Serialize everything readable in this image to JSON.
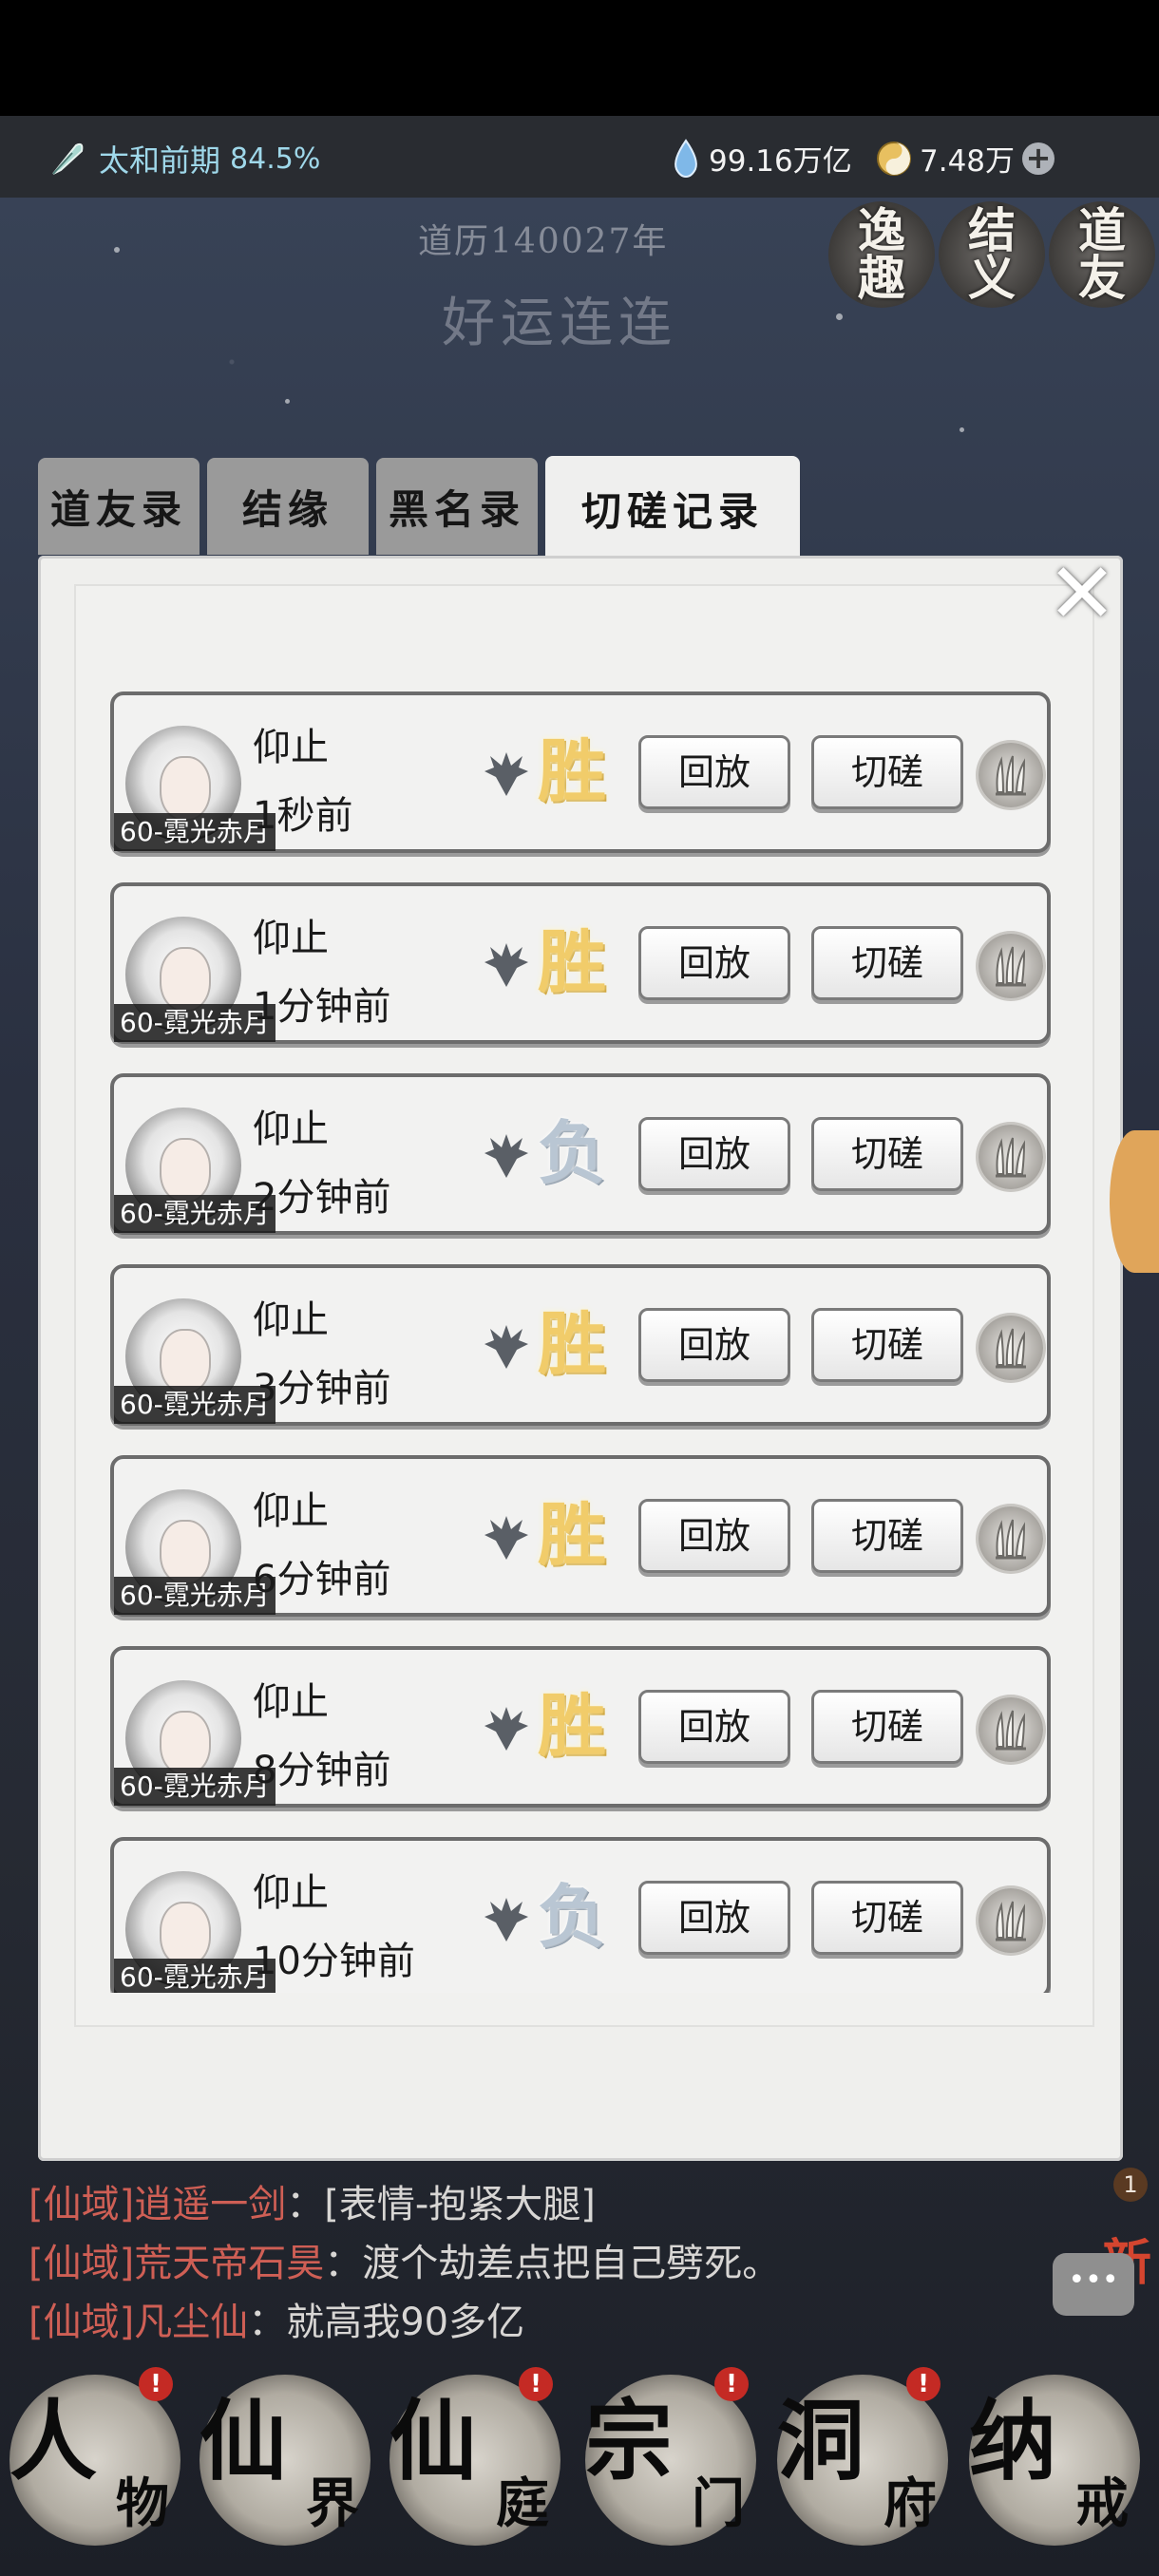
{
  "status_bar": {
    "realm_name": "太和前期",
    "realm_progress": "84.5%",
    "spirit_stones": "99.16万亿",
    "currency2": "7.48万",
    "plus_symbol": "+",
    "icons": [
      "feather-icon",
      "water-drop-icon",
      "taiji-icon",
      "plus-icon"
    ]
  },
  "header": {
    "calendar": "道历140027年",
    "fortune": "好运连连",
    "corner_buttons": [
      {
        "top": "逸",
        "bottom": "趣"
      },
      {
        "top": "结",
        "bottom": "义"
      },
      {
        "top": "道",
        "bottom": "友"
      }
    ]
  },
  "tabs": [
    {
      "label": "道友录",
      "active": false
    },
    {
      "label": "结缘",
      "active": false
    },
    {
      "label": "黑名录",
      "active": false
    },
    {
      "label": "切磋记录",
      "active": true
    }
  ],
  "close_symbol": "✕",
  "records": [
    {
      "avatar_label": "60-霓光赤月",
      "name": "仰止",
      "time": "1秒前",
      "result": "胜",
      "replay": "回放",
      "spar": "切磋"
    },
    {
      "avatar_label": "60-霓光赤月",
      "name": "仰止",
      "time": "1分钟前",
      "result": "胜",
      "replay": "回放",
      "spar": "切磋"
    },
    {
      "avatar_label": "60-霓光赤月",
      "name": "仰止",
      "time": "2分钟前",
      "result": "负",
      "replay": "回放",
      "spar": "切磋"
    },
    {
      "avatar_label": "60-霓光赤月",
      "name": "仰止",
      "time": "3分钟前",
      "result": "胜",
      "replay": "回放",
      "spar": "切磋"
    },
    {
      "avatar_label": "60-霓光赤月",
      "name": "仰止",
      "time": "6分钟前",
      "result": "胜",
      "replay": "回放",
      "spar": "切磋"
    },
    {
      "avatar_label": "60-霓光赤月",
      "name": "仰止",
      "time": "8分钟前",
      "result": "胜",
      "replay": "回放",
      "spar": "切磋"
    },
    {
      "avatar_label": "60-霓光赤月",
      "name": "仰止",
      "time": "10分钟前",
      "result": "负",
      "replay": "回放",
      "spar": "切磋"
    }
  ],
  "chat": [
    {
      "channel": "[仙域]",
      "speaker": "逍遥一剑",
      "sep": "：",
      "message": "[表情-抱紧大腿]"
    },
    {
      "channel": "[仙域]",
      "speaker": "荒天帝石昊",
      "sep": "：",
      "message": "渡个劫差点把自己劈死。"
    },
    {
      "channel": "[仙域]",
      "speaker": "凡尘仙",
      "sep": "：",
      "message": "就高我90多亿"
    }
  ],
  "chat_badge": {
    "new_label": "新",
    "count": "1"
  },
  "bottom_nav": [
    {
      "big": "人",
      "small": "物",
      "badge": "!"
    },
    {
      "big": "仙",
      "small": "界",
      "badge": ""
    },
    {
      "big": "仙",
      "small": "庭",
      "badge": "!"
    },
    {
      "big": "宗",
      "small": "门",
      "badge": "!"
    },
    {
      "big": "洞",
      "small": "府",
      "badge": "!"
    },
    {
      "big": "纳",
      "small": "戒",
      "badge": ""
    }
  ],
  "colors": {
    "win": "#f1cc6a",
    "lose": "#b9c6d3",
    "chat_channel": "#cf5f55",
    "realm_text": "#9fd8ea"
  }
}
